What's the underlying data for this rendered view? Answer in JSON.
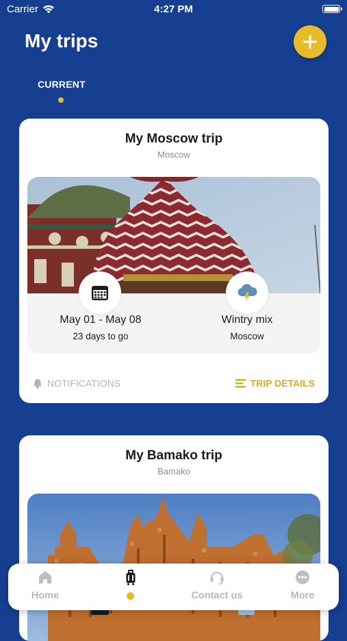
{
  "status_bar": {
    "carrier": "Carrier",
    "time": "4:27 PM"
  },
  "header": {
    "title": "My trips"
  },
  "tabs": {
    "current": "CURRENT"
  },
  "trips": [
    {
      "title": "My Moscow trip",
      "city": "Moscow",
      "dates": "May 01 - May 08",
      "countdown": "23 days to go",
      "weather": "Wintry mix",
      "weather_location": "Moscow",
      "notifications_label": "NOTIFICATIONS",
      "details_label": "TRIP DETAILS"
    },
    {
      "title": "My Bamako trip",
      "city": "Bamako"
    }
  ],
  "tabbar": {
    "home": "Home",
    "contact": "Contact us",
    "more": "More"
  },
  "colors": {
    "background": "#163f92",
    "accent": "#e8bb2a",
    "details": "#d9ac16"
  },
  "icons": {
    "add": "plus-icon",
    "calendar": "calendar-icon",
    "weather": "thunder-cloud-icon",
    "bell": "bell-icon",
    "details": "list-icon",
    "home": "home-icon",
    "trips": "luggage-icon",
    "contact": "headset-icon",
    "more": "more-dots-icon"
  }
}
